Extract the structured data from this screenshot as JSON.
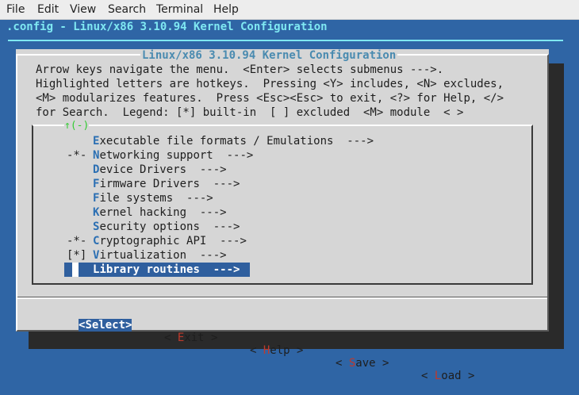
{
  "menubar": [
    "File",
    "Edit",
    "View",
    "Search",
    "Terminal",
    "Help"
  ],
  "window_title": ".config - Linux/x86 3.10.94 Kernel Configuration",
  "dialog": {
    "title": "Linux/x86 3.10.94 Kernel Configuration",
    "help": [
      "Arrow keys navigate the menu.  <Enter> selects submenus --->.",
      "Highlighted letters are hotkeys.  Pressing <Y> includes, <N> excludes,",
      "<M> modularizes features.  Press <Esc><Esc> to exit, <?> for Help, </>",
      "for Search.  Legend: [*] built-in  [ ] excluded  <M> module  < >"
    ],
    "scroll_indicator": "↑(-)",
    "items": [
      {
        "prefix": "",
        "hot": "E",
        "rest": "xecutable file formats / Emulations  --->"
      },
      {
        "prefix": "-*-",
        "hot": "N",
        "rest": "etworking support  --->"
      },
      {
        "prefix": "",
        "hot": "D",
        "rest": "evice Drivers  --->"
      },
      {
        "prefix": "",
        "hot": "F",
        "rest": "irmware Drivers  --->"
      },
      {
        "prefix": "",
        "hot": "F",
        "rest": "ile systems  --->"
      },
      {
        "prefix": "",
        "hot": "K",
        "rest": "ernel hacking  --->"
      },
      {
        "prefix": "",
        "hot": "S",
        "rest": "ecurity options  --->"
      },
      {
        "prefix": "-*-",
        "hot": "C",
        "rest": "ryptographic API  --->"
      },
      {
        "prefix": "[*]",
        "hot": "V",
        "rest": "irtualization  --->"
      },
      {
        "prefix": "",
        "hot": "L",
        "rest": "ibrary routines  --->",
        "selected": true
      }
    ],
    "buttons": [
      {
        "pre": "<",
        "hot": "S",
        "post": "elect>",
        "active": true
      },
      {
        "pre": "< ",
        "hot": "E",
        "post": "xit >"
      },
      {
        "pre": "< ",
        "hot": "H",
        "post": "elp >"
      },
      {
        "pre": "< ",
        "hot": "S",
        "post": "ave >"
      },
      {
        "pre": "< ",
        "hot": "L",
        "post": "oad >"
      }
    ]
  }
}
